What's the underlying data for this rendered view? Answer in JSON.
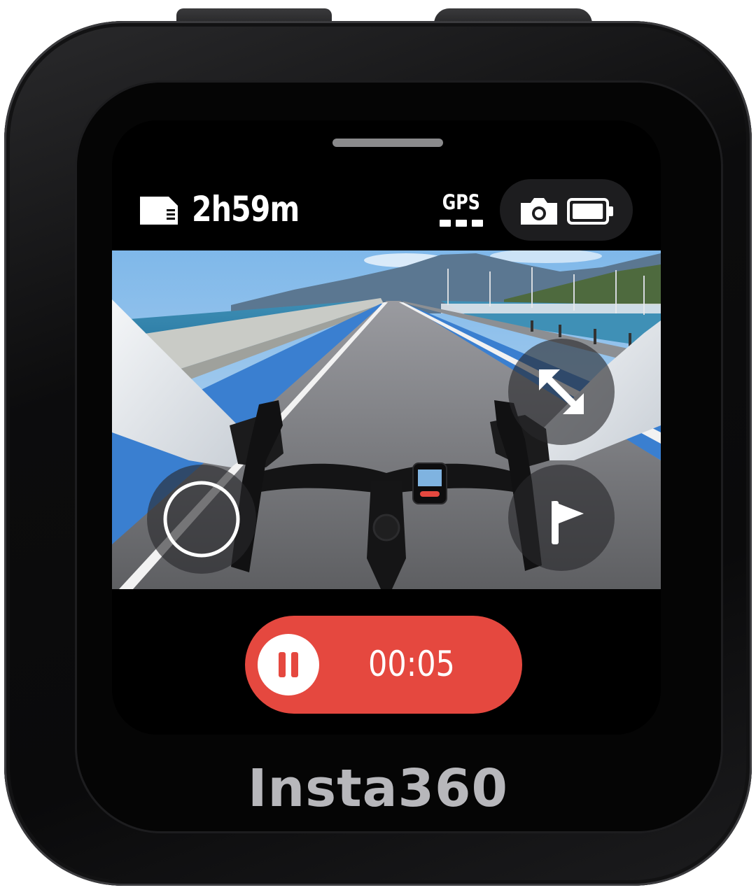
{
  "device": {
    "brand": "Insta360",
    "colors": {
      "body": "#0c0c0d",
      "record_accent": "#e5483f",
      "brand_text": "#b7b7bb"
    }
  },
  "status_bar": {
    "storage_icon": "sd-card-icon",
    "storage_remaining": "2h59m",
    "gps_label": "GPS",
    "gps_signal_bars": 3,
    "mode_icon": "camera-icon",
    "battery_icon": "battery-icon",
    "battery_level": 0.9
  },
  "controls": {
    "expand_icon": "expand-arrows-icon",
    "flag_icon": "flag-icon",
    "shutter_icon": "shutter-ring-icon"
  },
  "recording": {
    "pause_icon": "pause-icon",
    "elapsed": "00:05"
  }
}
